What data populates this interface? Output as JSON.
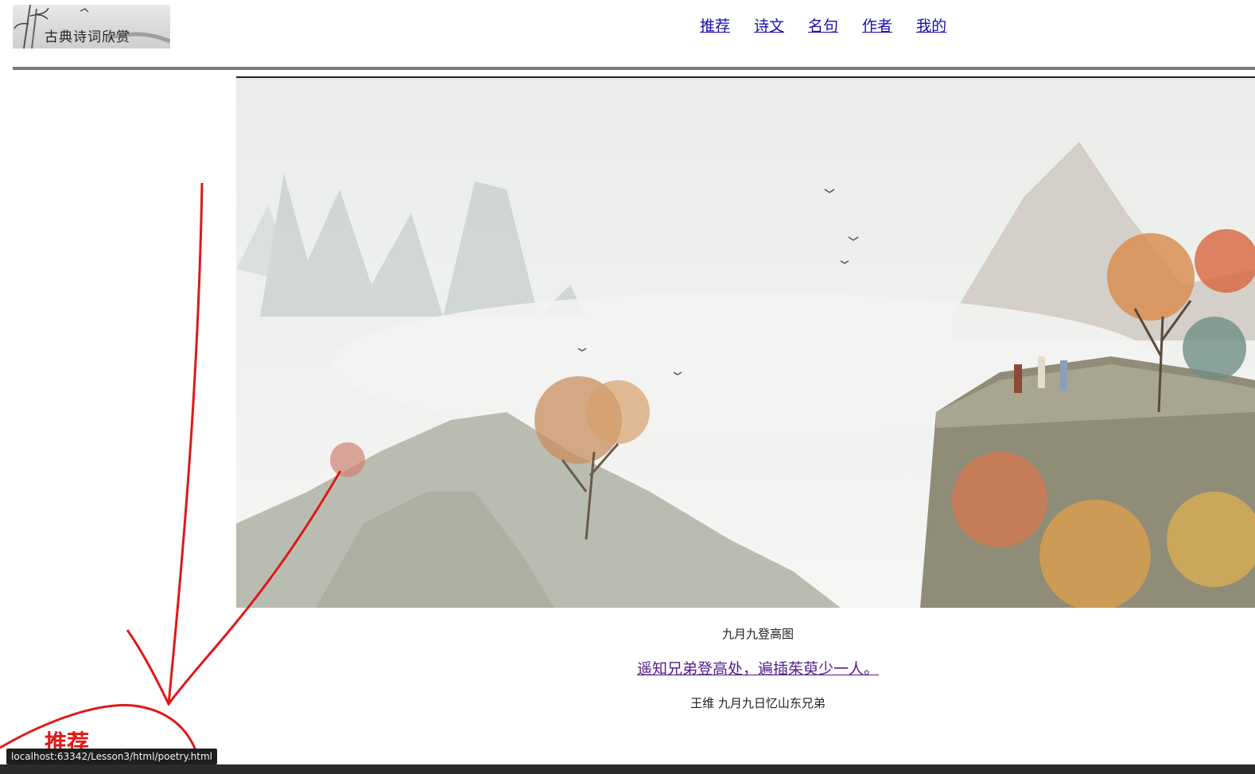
{
  "logo": {
    "text": "古典诗词欣赏"
  },
  "nav": [
    {
      "label": "推荐"
    },
    {
      "label": "诗文"
    },
    {
      "label": "名句"
    },
    {
      "label": "作者"
    },
    {
      "label": "我的"
    }
  ],
  "hero": {
    "caption": "九月九登高图"
  },
  "poem": {
    "line": "遥知兄弟登高处，遍插茱萸少一人。",
    "attribution": "王维 九月九日忆山东兄弟"
  },
  "section": {
    "heading": "推荐"
  },
  "status_bar": {
    "url": "localhost:63342/Lesson3/html/poetry.html"
  },
  "colors": {
    "link": "#1a0dab",
    "visited_link": "#551a8b",
    "annotation_red": "#e01818"
  }
}
